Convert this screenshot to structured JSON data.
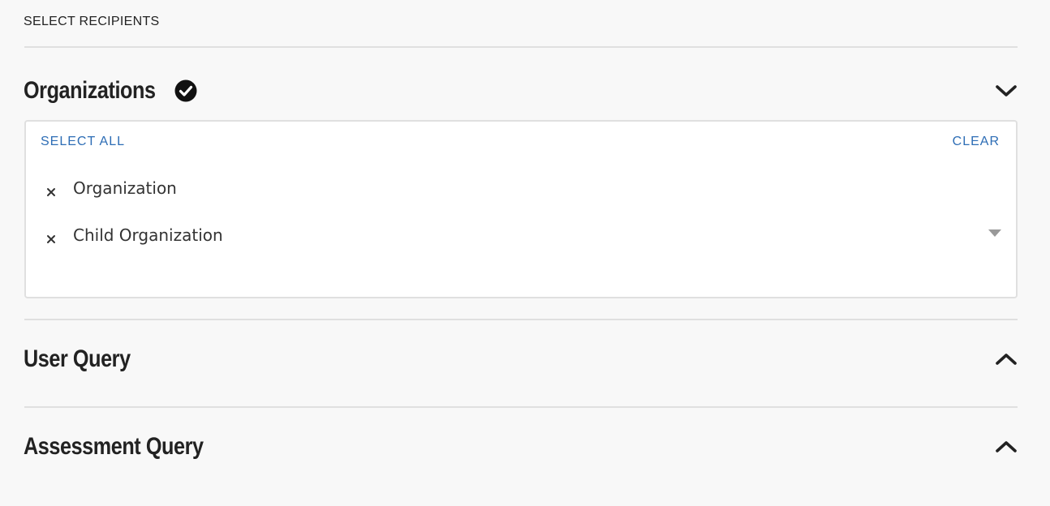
{
  "header": {
    "section_label": "SELECT RECIPIENTS"
  },
  "panels": [
    {
      "title": "Organizations",
      "completed": true,
      "expanded": true,
      "chevron_icon": "chevron-down-icon"
    },
    {
      "title": "User Query",
      "expanded": false,
      "chevron_icon": "chevron-up-icon"
    },
    {
      "title": "Assessment Query",
      "expanded": false,
      "chevron_icon": "chevron-up-icon"
    }
  ],
  "organizations_select": {
    "select_all_label": "SELECT ALL",
    "clear_label": "CLEAR",
    "selected": [
      {
        "label": "Organization"
      },
      {
        "label": "Child Organization"
      }
    ],
    "remove_icon": "close-icon",
    "dropdown_icon": "caret-down-icon"
  },
  "colors": {
    "background": "#f8f8f8",
    "text": "#222222",
    "link": "#2d6db5",
    "border": "#e0e0e0",
    "caret": "#999999"
  }
}
